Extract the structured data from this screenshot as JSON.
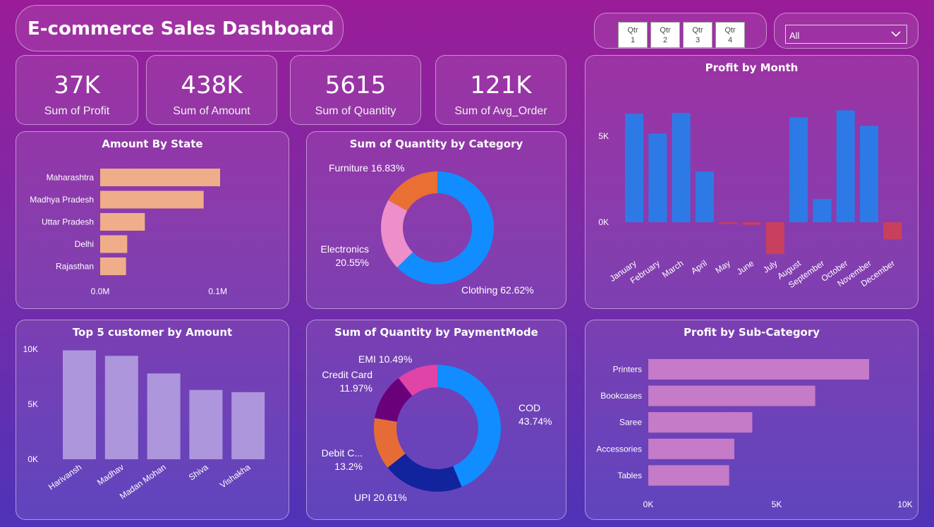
{
  "title": "E-commerce Sales Dashboard",
  "quarters": [
    "Qtr 1",
    "Qtr 2",
    "Qtr 3",
    "Qtr 4"
  ],
  "slicer": {
    "selected": "All"
  },
  "kpis": [
    {
      "value": "37K",
      "label": "Sum of Profit"
    },
    {
      "value": "438K",
      "label": "Sum of Amount"
    },
    {
      "value": "5615",
      "label": "Sum of Quantity"
    },
    {
      "value": "121K",
      "label": "Sum of Avg_Order"
    }
  ],
  "colors": {
    "state_bar": "#f0ad8a",
    "month_pos": "#2d7ae6",
    "month_neg": "#c8405e",
    "customer_bar": "#ad96dc",
    "subcat_bar": "#c57bc8"
  },
  "chart_data": [
    {
      "id": "amount_by_state",
      "type": "bar",
      "orientation": "horizontal",
      "title": "Amount By State",
      "categories": [
        "Maharashtra",
        "Madhya Pradesh",
        "Uttar Pradesh",
        "Delhi",
        "Rajasthan"
      ],
      "values": [
        0.102,
        0.088,
        0.038,
        0.023,
        0.022
      ],
      "xlim": [
        0,
        0.12
      ],
      "xticks": [
        0,
        0.1
      ],
      "xtick_labels": [
        "0.0M",
        "0.1M"
      ]
    },
    {
      "id": "quantity_by_category",
      "type": "pie",
      "donut": true,
      "title": "Sum of Quantity by Category",
      "labels": [
        "Clothing",
        "Electronics",
        "Furniture"
      ],
      "values": [
        62.62,
        20.55,
        16.83
      ],
      "label_text": [
        "Clothing 62.62%",
        "Electronics\n20.55%",
        "Furniture 16.83%"
      ],
      "colors": [
        "#118dff",
        "#ec8fcb",
        "#e96f33"
      ]
    },
    {
      "id": "profit_by_month",
      "type": "bar",
      "title": "Profit by Month",
      "categories": [
        "January",
        "February",
        "March",
        "April",
        "May",
        "June",
        "July",
        "August",
        "September",
        "October",
        "November",
        "December"
      ],
      "values": [
        6300,
        5150,
        6350,
        2950,
        -100,
        -150,
        -1850,
        6100,
        1350,
        6500,
        5600,
        -1000
      ],
      "ylim": [
        -2000,
        7500
      ],
      "yticks": [
        0,
        5000
      ],
      "ytick_labels": [
        "0K",
        "5K"
      ]
    },
    {
      "id": "top5_customers",
      "type": "bar",
      "title": "Top 5 customer by Amount",
      "categories": [
        "Harivansh",
        "Madhav",
        "Madan Mohan",
        "Shiva",
        "Vishakha"
      ],
      "values": [
        9900,
        9400,
        7800,
        6300,
        6100
      ],
      "ylim": [
        0,
        10000
      ],
      "yticks": [
        0,
        5000,
        10000
      ],
      "ytick_labels": [
        "0K",
        "5K",
        "10K"
      ]
    },
    {
      "id": "quantity_by_paymentmode",
      "type": "pie",
      "donut": true,
      "title": "Sum of Quantity by PaymentMode",
      "labels": [
        "COD",
        "UPI",
        "Debit Card",
        "Credit Card",
        "EMI"
      ],
      "values": [
        43.74,
        20.61,
        13.2,
        11.97,
        10.49
      ],
      "label_text": [
        "COD\n43.74%",
        "UPI 20.61%",
        "Debit C...\n13.2%",
        "Credit Card\n11.97%",
        "EMI 10.49%"
      ],
      "colors": [
        "#118dff",
        "#12239e",
        "#e66c37",
        "#6b007b",
        "#e044a7"
      ]
    },
    {
      "id": "profit_by_subcategory",
      "type": "bar",
      "orientation": "horizontal",
      "title": "Profit by Sub-Category",
      "categories": [
        "Printers",
        "Bookcases",
        "Saree",
        "Accessories",
        "Tables"
      ],
      "values": [
        8600,
        6500,
        4050,
        3350,
        3150
      ],
      "xlim": [
        0,
        10000
      ],
      "xticks": [
        0,
        5000,
        10000
      ],
      "xtick_labels": [
        "0K",
        "5K",
        "10K"
      ]
    }
  ]
}
